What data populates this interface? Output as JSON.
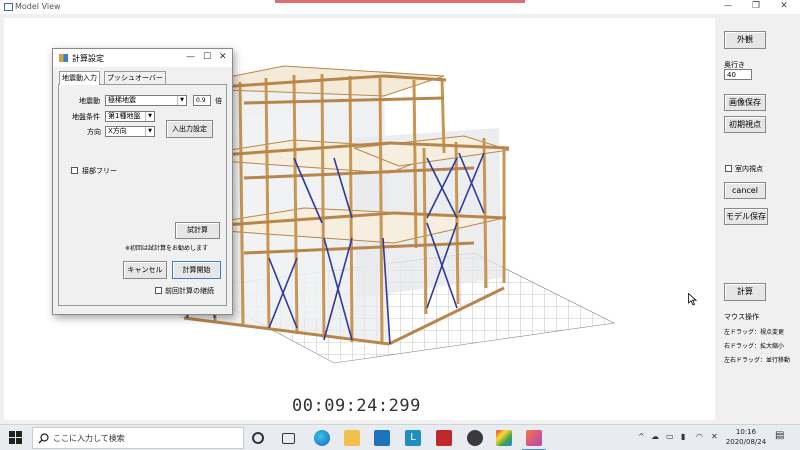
{
  "window": {
    "title": "Model View",
    "minimize": "—",
    "restore": "❐",
    "close": "✕"
  },
  "viewport": {
    "timer": "00:09:24:299"
  },
  "right_panel": {
    "exterior_button": "外観",
    "depth_label": "奥行き",
    "depth_value": "40",
    "save_image_button": "画像保存",
    "initial_view_button": "初期視点",
    "indoor_view_label": "室内視点",
    "cancel_button": "cancel",
    "save_model_button": "モデル保存",
    "calc_button": "計算",
    "mouse_title": "マウス操作",
    "mouse_left": "左ドラッグ：視点変更",
    "mouse_right": "右ドラッグ：拡大縮小",
    "mouse_both": "左右ドラッグ：並行移動"
  },
  "dialog": {
    "title": "計算設定",
    "tabs": [
      "地震動入力",
      "プッシュオーバー"
    ],
    "seismic_label": "地震動",
    "seismic_value": "極稀地震",
    "factor_value": "0.9",
    "factor_unit": "倍",
    "ground_label": "地盤条件",
    "ground_value": "第1種地盤",
    "direction_label": "方向",
    "direction_value": "X方向",
    "io_settings_button": "入出力設定",
    "joint_free_label": "接部フリー",
    "trial_calc_button": "試計算",
    "note": "※初回は試計算をお勧めします",
    "cancel_button": "キャンセル",
    "start_button": "計算開始",
    "continue_label": "前回計算の継続"
  },
  "taskbar": {
    "search_placeholder": "ここに入力して検索",
    "time": "10:16",
    "date": "2020/08/24"
  }
}
